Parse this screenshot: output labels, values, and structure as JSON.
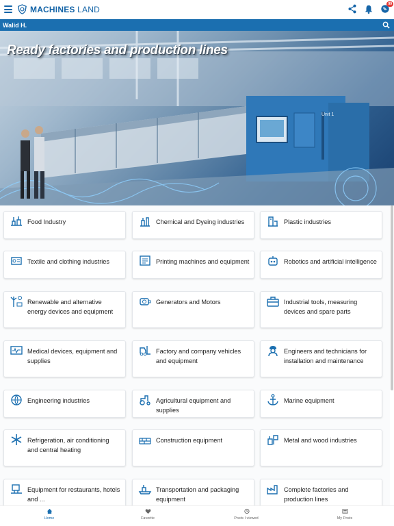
{
  "app": {
    "logo_text_bold": "MACHINES",
    "logo_text_thin": "LAND",
    "notification_badge": "99"
  },
  "user": {
    "name": "Walid H."
  },
  "hero": {
    "title": "Ready factories and production lines"
  },
  "categories": [
    {
      "label": "Food Industry",
      "icon": "food-industry-icon"
    },
    {
      "label": "Chemical and Dyeing industries",
      "icon": "chemical-industry-icon"
    },
    {
      "label": "Plastic industries",
      "icon": "plastic-industry-icon"
    },
    {
      "label": "Textile and clothing industries",
      "icon": "textile-icon"
    },
    {
      "label": "Printing machines and equipment",
      "icon": "printing-icon"
    },
    {
      "label": "Robotics and artificial intelligence",
      "icon": "robot-icon"
    },
    {
      "label": "Renewable and alternative energy devices and equipment",
      "icon": "renewable-energy-icon"
    },
    {
      "label": "Generators and Motors",
      "icon": "generator-icon"
    },
    {
      "label": "Industrial tools, measuring devices and spare parts",
      "icon": "toolbox-icon"
    },
    {
      "label": "Medical devices, equipment and supplies",
      "icon": "medical-monitor-icon"
    },
    {
      "label": "Factory and company vehicles and equipment",
      "icon": "forklift-icon"
    },
    {
      "label": "Engineers and technicians for installation and maintenance",
      "icon": "engineer-icon"
    },
    {
      "label": "Engineering industries",
      "icon": "globe-gear-icon"
    },
    {
      "label": "Agricultural equipment and supplies",
      "icon": "tractor-icon"
    },
    {
      "label": "Marine equipment",
      "icon": "anchor-icon"
    },
    {
      "label": "Refrigeration, air conditioning and central heating",
      "icon": "snowflake-icon"
    },
    {
      "label": "Construction equipment",
      "icon": "bricks-icon"
    },
    {
      "label": "Metal and wood industries",
      "icon": "metal-wood-icon"
    },
    {
      "label": "Equipment for restaurants, hotels and ...",
      "icon": "restaurant-equipment-icon"
    },
    {
      "label": "Transportation and packaging equipment",
      "icon": "transport-icon"
    },
    {
      "label": "Complete factories and production lines",
      "icon": "factory-icon"
    }
  ],
  "bottom_nav": {
    "home": "Home",
    "favorite": "Favorite",
    "viewed": "Posts I viewed",
    "my_posts": "My Posts"
  },
  "colors": {
    "primary": "#1b6fb0",
    "badge": "#e53935"
  }
}
